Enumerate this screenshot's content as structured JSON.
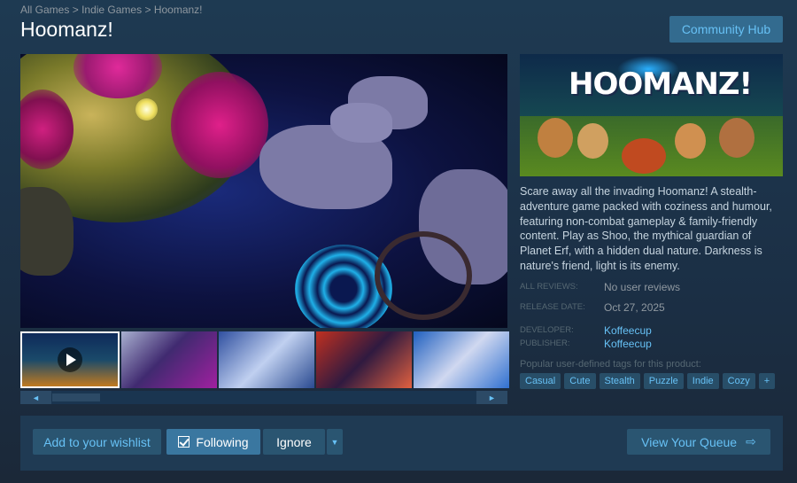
{
  "breadcrumb": {
    "items": [
      "All Games",
      "Indie Games",
      "Hoomanz!"
    ],
    "separator": ">"
  },
  "game": {
    "title": "Hoomanz!",
    "capsule_logo": "HOOMANZ!",
    "description": "Scare away all the invading Hoomanz! A stealth-adventure game packed with coziness and humour, featuring non-combat gameplay & family-friendly content. Play as Shoo, the mythical guardian of Planet Erf, with a hidden dual nature. Darkness is nature's friend, light is its enemy."
  },
  "header": {
    "community_hub_label": "Community Hub"
  },
  "meta": {
    "reviews_label": "ALL REVIEWS:",
    "reviews_value": "No user reviews",
    "release_label": "RELEASE DATE:",
    "release_value": "Oct 27, 2025",
    "developer_label": "DEVELOPER:",
    "developer_value": "Koffeecup",
    "publisher_label": "PUBLISHER:",
    "publisher_value": "Koffeecup"
  },
  "tags": {
    "label": "Popular user-defined tags for this product:",
    "items": [
      "Casual",
      "Cute",
      "Stealth",
      "Puzzle",
      "Indie",
      "Cozy",
      "+"
    ]
  },
  "media": {
    "scroll_left_icon": "◄",
    "scroll_right_icon": "►"
  },
  "actions": {
    "wishlist_label": "Add to your wishlist",
    "following_label": "Following",
    "ignore_label": "Ignore",
    "dropdown_icon": "▼",
    "queue_label": "View Your Queue",
    "queue_icon": "⇨"
  },
  "colors": {
    "accent": "#67c1f5",
    "link": "#66c0f4",
    "background": "#1b2838"
  }
}
